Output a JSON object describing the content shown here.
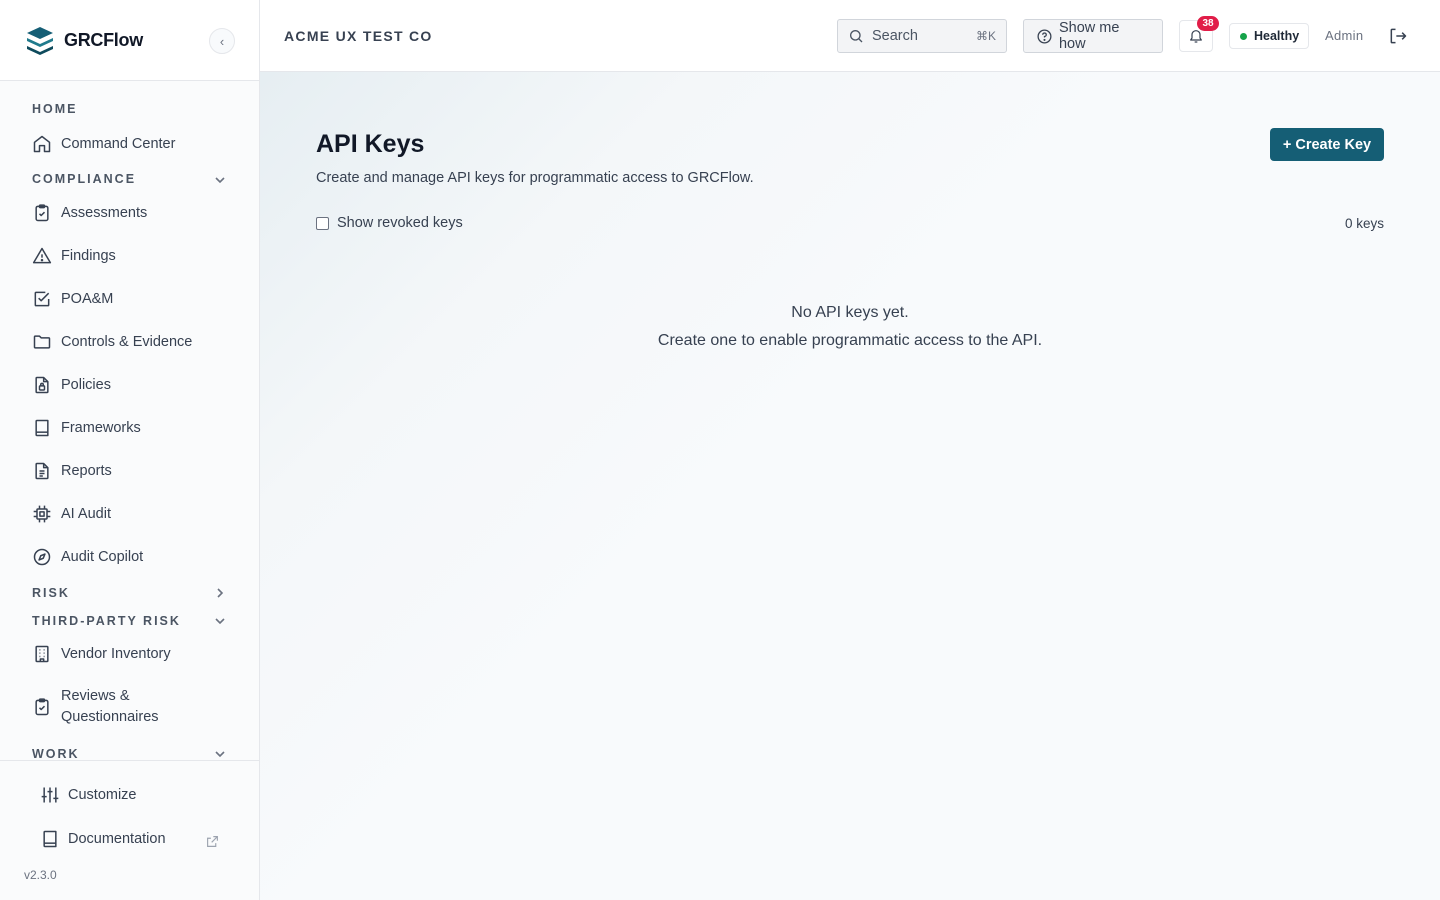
{
  "brand": {
    "name": "GRCFlow",
    "collapse_glyph": "‹"
  },
  "nav": {
    "sections": {
      "home": "HOME",
      "compliance": "COMPLIANCE",
      "risk": "RISK",
      "third_party": "THIRD-PARTY RISK",
      "work": "WORK"
    },
    "items": {
      "command_center": "Command Center",
      "assessments": "Assessments",
      "findings": "Findings",
      "poam": "POA&M",
      "controls": "Controls & Evidence",
      "policies": "Policies",
      "frameworks": "Frameworks",
      "reports": "Reports",
      "ai_audit": "AI Audit",
      "audit_copilot": "Audit Copilot",
      "vendor_inventory": "Vendor Inventory",
      "reviews_1": "Reviews &",
      "reviews_2": "Questionnaires"
    }
  },
  "footer": {
    "customize": "Customize",
    "documentation": "Documentation",
    "version": "v2.3.0"
  },
  "header": {
    "org": "ACME UX TEST CO",
    "search_placeholder": "Search",
    "search_shortcut": "⌘K",
    "show_me_how": "Show me how",
    "notification_count": "38",
    "health": "Healthy",
    "user": "Admin"
  },
  "main": {
    "title": "API Keys",
    "subtitle": "Create and manage API keys for programmatic access to GRCFlow.",
    "create_button": "+ Create Key",
    "show_revoked": "Show revoked keys",
    "key_count": "0 keys",
    "empty_line1": "No API keys yet.",
    "empty_line2": "Create one to enable programmatic access to the API."
  },
  "colors": {
    "primary": "#155e75",
    "badge": "#e11d48",
    "healthy": "#16a34a"
  }
}
